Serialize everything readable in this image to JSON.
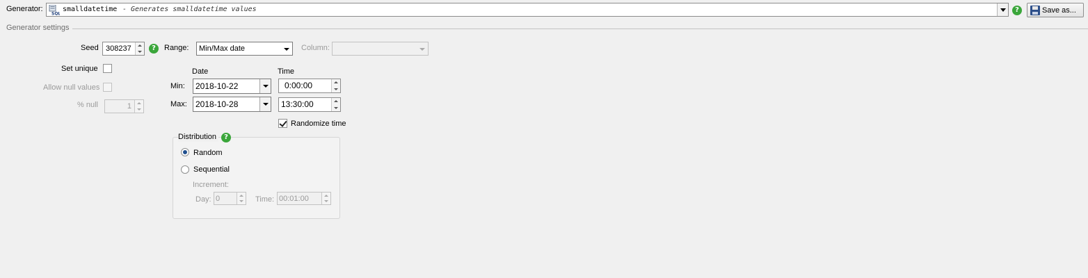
{
  "generator": {
    "label": "Generator:",
    "name": "smalldatetime",
    "description": "- Generates smalldatetime values",
    "icon": "sql-icon",
    "save_label": "Save as..."
  },
  "settings": {
    "group_title": "Generator settings",
    "seed_label": "Seed",
    "seed_value": "308237",
    "range_label": "Range:",
    "range_value": "Min/Max date",
    "column_label": "Column:",
    "column_value": "",
    "set_unique_label": "Set unique",
    "set_unique_checked": false,
    "allow_null_label": "Allow null values",
    "allow_null_checked": false,
    "percent_null_label": "% null",
    "percent_null_value": "1"
  },
  "range": {
    "date_header": "Date",
    "time_header": "Time",
    "min_label": "Min:",
    "max_label": "Max:",
    "min_date": "2018-10-22",
    "max_date": "2018-10-28",
    "min_time": "0:00:00",
    "max_time": "13:30:00",
    "randomize_time_label": "Randomize time",
    "randomize_time_checked": true
  },
  "distribution": {
    "title": "Distribution",
    "random_label": "Random",
    "sequential_label": "Sequential",
    "selected": "Random",
    "increment_label": "Increment:",
    "day_label": "Day:",
    "day_value": "0",
    "time_label": "Time:",
    "time_value": "00:01:00"
  },
  "colors": {
    "background": "#f0f0f0",
    "help_icon": "#3aa63a",
    "disabled_text": "#9a9a9a"
  }
}
